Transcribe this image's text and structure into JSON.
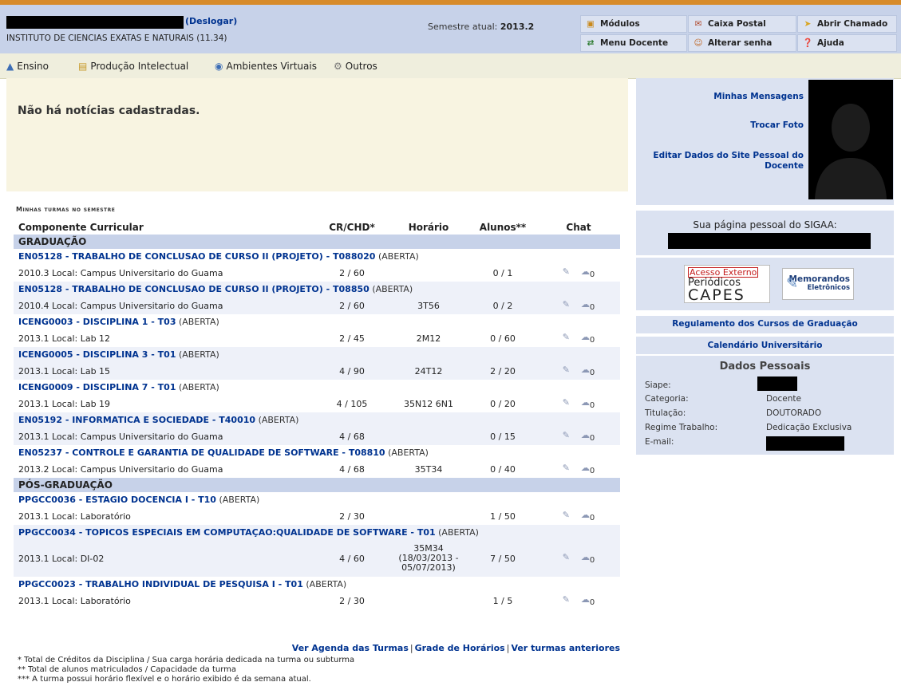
{
  "header": {
    "logout_label": "(Deslogar)",
    "institution": "INSTITUTO DE CIENCIAS EXATAS E NATURAIS (11.34)",
    "semester_label": "Semestre atual:",
    "semester_value": "2013.2",
    "buttons": [
      {
        "label": "Módulos",
        "icon": "modules-icon"
      },
      {
        "label": "Caixa Postal",
        "icon": "mailbox-icon"
      },
      {
        "label": "Abrir Chamado",
        "icon": "ticket-icon"
      },
      {
        "label": "Menu Docente",
        "icon": "teacher-menu-icon"
      },
      {
        "label": "Alterar senha",
        "icon": "password-icon"
      },
      {
        "label": "Ajuda",
        "icon": "help-icon"
      }
    ]
  },
  "menu": {
    "items": [
      {
        "label": "Ensino",
        "icon": "teaching-icon"
      },
      {
        "label": "Produção Intelectual",
        "icon": "production-icon"
      },
      {
        "label": "Ambientes Virtuais",
        "icon": "virtual-env-icon"
      },
      {
        "label": "Outros",
        "icon": "others-icon"
      }
    ]
  },
  "news": {
    "message": "Não há notícias cadastradas."
  },
  "turmas": {
    "caption": "Minhas turmas no semestre",
    "columns": [
      "Componente Curricular",
      "CR/CHD*",
      "Horário",
      "Alunos**",
      "Chat"
    ],
    "sections": [
      {
        "title": "GRADUAÇÃO",
        "rows": [
          {
            "code": "EN05128 - TRABALHO DE CONCLUSAO DE CURSO II (PROJETO) - T088020",
            "status": "(ABERTA)",
            "detail": "2010.3 Local: Campus Universitario do Guama",
            "cr": "2 / 60",
            "horario": "",
            "alunos": "0 / 1",
            "chat": "0"
          },
          {
            "code": "EN05128 - TRABALHO DE CONCLUSAO DE CURSO II (PROJETO) - T08850",
            "status": "(ABERTA)",
            "detail": "2010.4 Local: Campus Universitario do Guama",
            "cr": "2 / 60",
            "horario": "3T56",
            "alunos": "0 / 2",
            "chat": "0"
          },
          {
            "code": "ICENG0003 - DISCIPLINA 1 - T03",
            "status": "(ABERTA)",
            "detail": "2013.1 Local: Lab 12",
            "cr": "2 / 45",
            "horario": "2M12",
            "alunos": "0 / 60",
            "chat": "0"
          },
          {
            "code": "ICENG0005 - DISCIPLINA 3 - T01",
            "status": "(ABERTA)",
            "detail": "2013.1 Local: Lab 15",
            "cr": "4 / 90",
            "horario": "24T12",
            "alunos": "2 / 20",
            "chat": "0"
          },
          {
            "code": "ICENG0009 - DISCIPLINA 7 - T01",
            "status": "(ABERTA)",
            "detail": "2013.1 Local: Lab 19",
            "cr": "4 / 105",
            "horario": "35N12 6N1",
            "alunos": "0 / 20",
            "chat": "0"
          },
          {
            "code": "EN05192 - INFORMATICA E SOCIEDADE - T40010",
            "status": "(ABERTA)",
            "detail": "2013.1 Local: Campus Universitario do Guama",
            "cr": "4 / 68",
            "horario": "",
            "alunos": "0 / 15",
            "chat": "0"
          },
          {
            "code": "EN05237 - CONTROLE E GARANTIA DE QUALIDADE DE SOFTWARE - T08810",
            "status": "(ABERTA)",
            "detail": "2013.2 Local: Campus Universitario do Guama",
            "cr": "4 / 68",
            "horario": "35T34",
            "alunos": "0 / 40",
            "chat": "0"
          }
        ]
      },
      {
        "title": "PÓS-GRADUAÇÃO",
        "rows": [
          {
            "code": "PPGCC0036 - ESTAGIO DOCENCIA I - T10",
            "status": "(ABERTA)",
            "detail": "2013.1 Local: Laboratório",
            "cr": "2 / 30",
            "horario": "",
            "alunos": "1 / 50",
            "chat": "0"
          },
          {
            "code": "PPGCC0034 - TOPICOS ESPECIAIS EM COMPUTAÇAO:QUALIDADE DE SOFTWARE - T01",
            "status": "(ABERTA)",
            "detail": "2013.1 Local: DI-02",
            "cr": "4 / 60",
            "horario": "35M34 (18/03/2013 - 05/07/2013)",
            "alunos": "7 / 50",
            "chat": "0"
          },
          {
            "code": "PPGCC0023 - TRABALHO INDIVIDUAL DE PESQUISA I - T01",
            "status": "(ABERTA)",
            "detail": "2013.1 Local: Laboratório",
            "cr": "2 / 30",
            "horario": "",
            "alunos": "1 / 5",
            "chat": "0"
          }
        ]
      }
    ],
    "footer_links": [
      "Ver Agenda das Turmas",
      "Grade de Horários",
      "Ver turmas anteriores"
    ],
    "footnotes": [
      "* Total de Créditos da Disciplina / Sua carga horária dedicada na turma ou subturma",
      "** Total de alunos matriculados / Capacidade da turma",
      "*** A turma possui horário flexível e o horário exibido é da semana atual."
    ]
  },
  "sidebar": {
    "links": [
      "Minhas Mensagens",
      "Trocar Foto",
      "Editar Dados do Site Pessoal do Docente"
    ],
    "personal_page_label": "Sua página pessoal do SIGAA:",
    "capes_line1": "Acesso Externo",
    "capes_line2": "Periódicos",
    "capes_line3": "CAPES",
    "memo_line1": "Memorandos",
    "memo_line2": "Eletrônicos",
    "regulamento": "Regulamento dos Cursos de Graduação",
    "calendario": "Calendário Universitário",
    "dados_title": "Dados Pessoais",
    "dados": [
      {
        "label": "Siape:",
        "value": ""
      },
      {
        "label": "Categoria:",
        "value": "Docente"
      },
      {
        "label": "Titulação:",
        "value": "DOUTORADO"
      },
      {
        "label": "Regime Trabalho:",
        "value": "Dedicação Exclusiva"
      },
      {
        "label": "E-mail:",
        "value": ""
      }
    ]
  }
}
